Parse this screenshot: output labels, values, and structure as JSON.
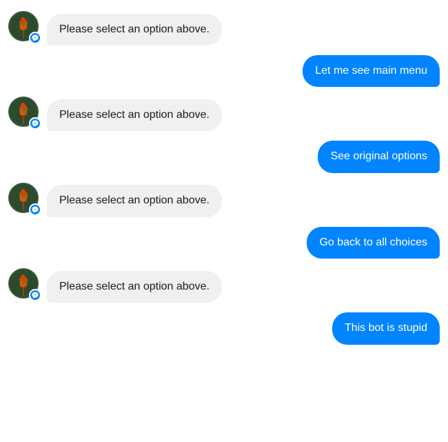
{
  "messages": [
    {
      "id": 1,
      "type": "bot",
      "text": "Please select an option above."
    },
    {
      "id": 2,
      "type": "user",
      "text": "Let me see main menu"
    },
    {
      "id": 3,
      "type": "bot",
      "text": "Please select an option above."
    },
    {
      "id": 4,
      "type": "user",
      "text": "See original options"
    },
    {
      "id": 5,
      "type": "bot",
      "text": "Please select an option above."
    },
    {
      "id": 6,
      "type": "user",
      "text": "Go back to all choices"
    },
    {
      "id": 7,
      "type": "bot",
      "text": "Please select an option above."
    },
    {
      "id": 8,
      "type": "user",
      "text": "This bot is stupid"
    }
  ],
  "colors": {
    "user_bubble": "#0084ff",
    "bot_bubble": "#f0f0f0",
    "messenger_blue": "#0084ff"
  }
}
